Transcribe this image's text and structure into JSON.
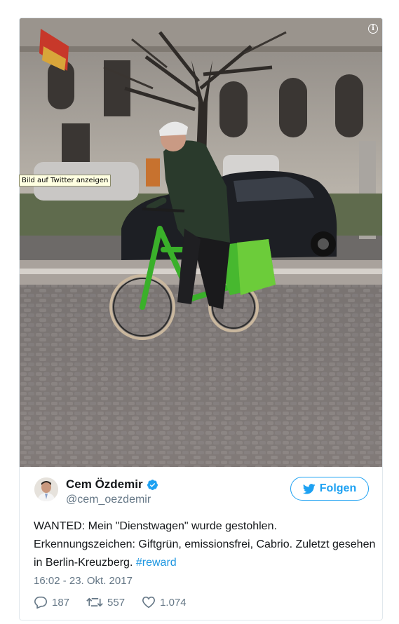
{
  "media": {
    "tooltip": "Bild auf Twitter anzeigen",
    "info_icon": "i"
  },
  "tweet": {
    "author": {
      "display_name": "Cem Özdemir",
      "handle": "@cem_oezdemir",
      "verified": true
    },
    "follow_label": "Folgen",
    "text_main": "WANTED: Mein \"Dienstwagen\" wurde gestohlen. Erkennungszeichen: Giftgrün, emissionsfrei, Cabrio. Zuletzt gesehen in Berlin-Kreuzberg.",
    "hashtag": "#reward",
    "timestamp": "16:02 - 23. Okt. 2017",
    "replies": "187",
    "retweets": "557",
    "likes": "1.074"
  },
  "colors": {
    "twitter_blue": "#1da1f2",
    "hashtag": "#1b95e0",
    "secondary_text": "#657786",
    "bike_green": "#3ab02a"
  }
}
